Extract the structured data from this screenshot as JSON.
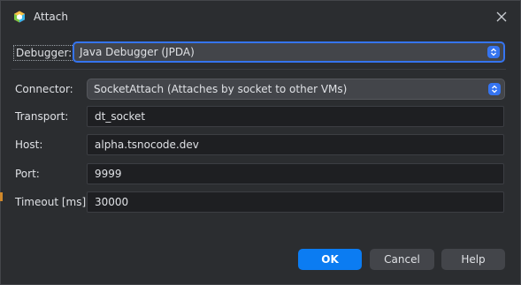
{
  "window": {
    "title": "Attach",
    "app_icon": "netbeans-cube-icon",
    "close_icon": "close-icon"
  },
  "debugger": {
    "label": "Debugger:",
    "value": "Java Debugger (JPDA)"
  },
  "connector": {
    "label": "Connector:",
    "value": "SocketAttach (Attaches by socket to other VMs)"
  },
  "transport": {
    "label": "Transport:",
    "value": "dt_socket"
  },
  "host": {
    "label": "Host:",
    "value": "alpha.tsnocode.dev"
  },
  "port": {
    "label": "Port:",
    "value": "9999"
  },
  "timeout": {
    "label": "Timeout [ms]:",
    "value": "30000"
  },
  "buttons": {
    "ok": "OK",
    "cancel": "Cancel",
    "help": "Help"
  },
  "colors": {
    "accent": "#3574f0",
    "primary_button": "#0b7cf2",
    "dialog_bg": "#2b2d30"
  }
}
